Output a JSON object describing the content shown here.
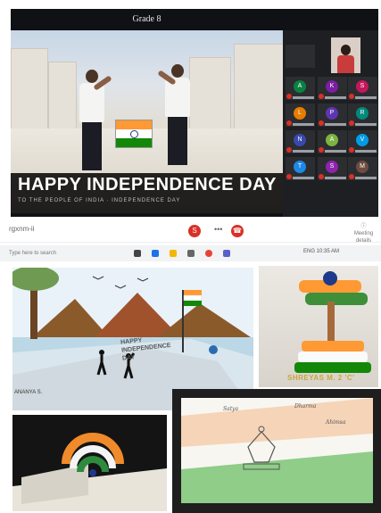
{
  "call": {
    "title": "Grade 8",
    "banner_text": "HAPPY INDEPENDENCE DAY",
    "banner_sub": "TO THE PEOPLE OF INDIA · INDEPENDENCE DAY",
    "tiles": [
      {
        "initial": "A",
        "color": "#0b8043"
      },
      {
        "initial": "K",
        "color": "#7b1fa2"
      },
      {
        "initial": "S",
        "color": "#c2185b"
      },
      {
        "initial": "L",
        "color": "#e67c00"
      },
      {
        "initial": "P",
        "color": "#5e35b1"
      },
      {
        "initial": "R",
        "color": "#00897b"
      },
      {
        "initial": "N",
        "color": "#3949ab"
      },
      {
        "initial": "A",
        "color": "#7cb342"
      },
      {
        "initial": "V",
        "color": "#039be5"
      },
      {
        "initial": "T",
        "color": "#1e88e5"
      },
      {
        "initial": "S",
        "color": "#8e24aa"
      },
      {
        "initial": "M",
        "color": "#6d4c41"
      }
    ]
  },
  "meetbar": {
    "code": "rgxnm-ii",
    "mic_icon": "S",
    "more_icon": "•••",
    "end_icon": "☎",
    "details_icon": "ⓘ",
    "details_label": "Meeting details"
  },
  "taskbar": {
    "search_placeholder": "Type here to search",
    "tray": "ENG 10:35 AM"
  },
  "collage": {
    "drawing_headline": "HAPPY INDEPENDENCE DAY",
    "drawing_caption": "ANANYA S.",
    "craft_label": "SHREYAS M. 2 'C'",
    "sketch_words": [
      "Satya",
      "Dharma",
      "Ahimsa"
    ]
  },
  "colors": {
    "saffron": "#ff9933",
    "white": "#ffffff",
    "green": "#138808",
    "navy": "#1e3a8a",
    "meet_red": "#d93025"
  }
}
